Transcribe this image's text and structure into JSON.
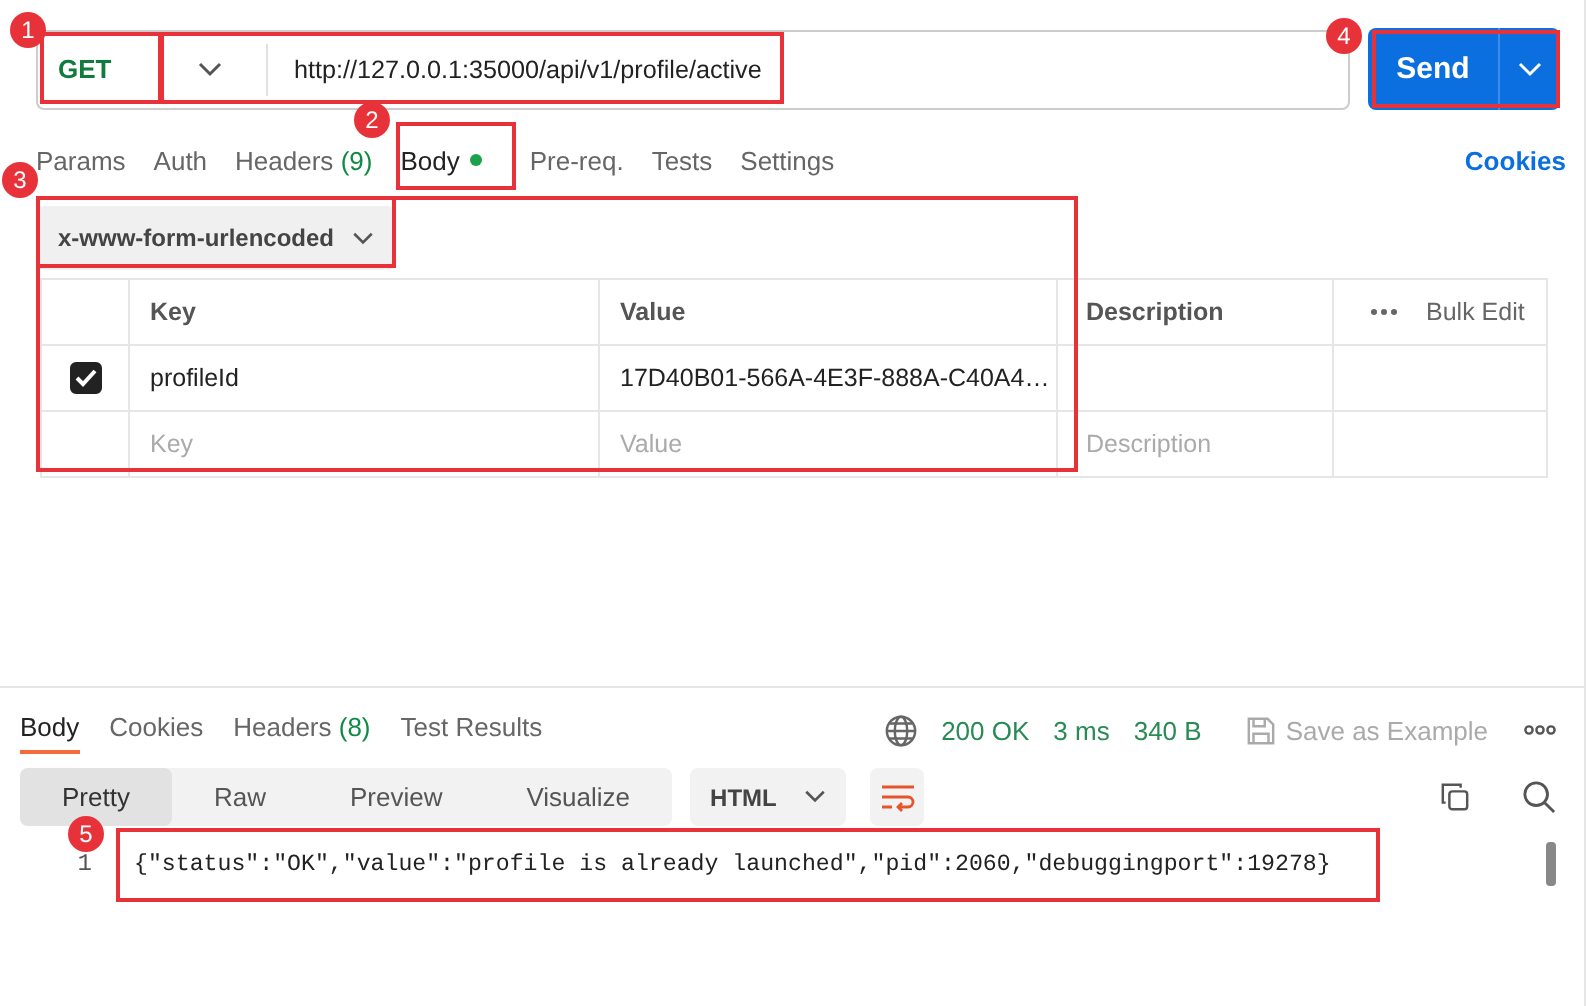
{
  "request": {
    "method": "GET",
    "url": "http://127.0.0.1:35000/api/v1/profile/active",
    "send": "Send"
  },
  "tabs": [
    {
      "label": "Params",
      "selected": false
    },
    {
      "label": "Auth",
      "selected": false
    },
    {
      "label": "Headers",
      "count": "(9)",
      "selected": false
    },
    {
      "label": "Body",
      "dot": true,
      "selected": true
    },
    {
      "label": "Pre-req.",
      "selected": false
    },
    {
      "label": "Tests",
      "selected": false
    },
    {
      "label": "Settings",
      "selected": false
    }
  ],
  "cookies": "Cookies",
  "body_type": "x-www-form-urlencoded",
  "table": {
    "columns": [
      "Key",
      "Value",
      "Description"
    ],
    "bulk_edit": "Bulk Edit",
    "rows": [
      {
        "checked": true,
        "key": "profileId",
        "value": "17D40B01-566A-4E3F-888A-C40A4…"
      }
    ],
    "placeholder": {
      "key": "Key",
      "value": "Value",
      "description": "Description"
    }
  },
  "response": {
    "tabs": [
      {
        "label": "Body",
        "selected": true
      },
      {
        "label": "Cookies",
        "selected": false
      },
      {
        "label": "Headers",
        "count": "(8)",
        "selected": false
      },
      {
        "label": "Test Results",
        "selected": false
      }
    ],
    "status": "200 OK",
    "time": "3 ms",
    "size": "340 B",
    "save": "Save as Example",
    "views": [
      {
        "label": "Pretty",
        "selected": true
      },
      {
        "label": "Raw",
        "selected": false
      },
      {
        "label": "Preview",
        "selected": false
      },
      {
        "label": "Visualize",
        "selected": false
      }
    ],
    "format": "HTML",
    "lines": [
      {
        "number": "1",
        "code": "{\"status\":\"OK\",\"value\":\"profile is already launched\",\"pid\":2060,\"debuggingport\":19278}"
      }
    ]
  },
  "annotations": [
    {
      "number": "1"
    },
    {
      "number": "2"
    },
    {
      "number": "3"
    },
    {
      "number": "4"
    },
    {
      "number": "5"
    }
  ]
}
